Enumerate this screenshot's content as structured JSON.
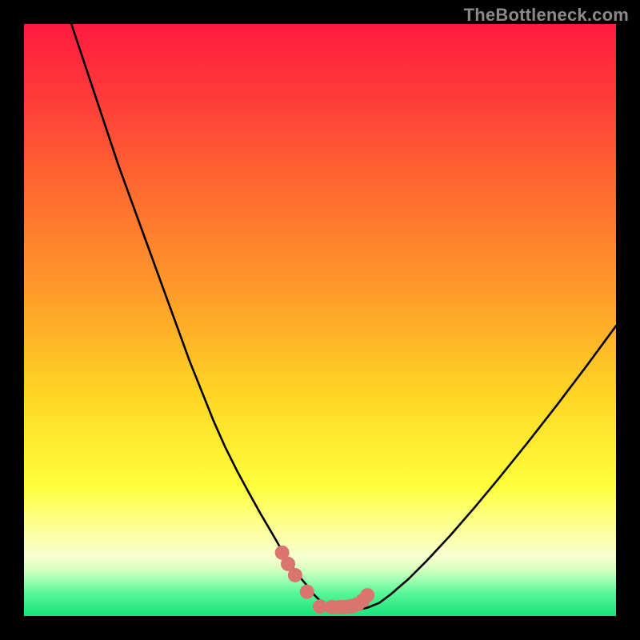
{
  "watermark": {
    "text": "TheBottleneck.com"
  },
  "chart_data": {
    "type": "line",
    "title": "",
    "xlabel": "",
    "ylabel": "",
    "xlim": [
      0,
      100
    ],
    "ylim": [
      0,
      100
    ],
    "grid": false,
    "legend": null,
    "gradient_stops": [
      {
        "pct": 0,
        "color": "#ff1b3f"
      },
      {
        "pct": 12,
        "color": "#ff3a3a"
      },
      {
        "pct": 28,
        "color": "#ff6a2f"
      },
      {
        "pct": 45,
        "color": "#ff9a2a"
      },
      {
        "pct": 62,
        "color": "#ffd324"
      },
      {
        "pct": 78,
        "color": "#ffff3a"
      },
      {
        "pct": 86,
        "color": "#fcffa0"
      },
      {
        "pct": 90,
        "color": "#f6ffd0"
      },
      {
        "pct": 92,
        "color": "#d9ffc0"
      },
      {
        "pct": 94,
        "color": "#9dffb0"
      },
      {
        "pct": 96,
        "color": "#5cf79a"
      },
      {
        "pct": 100,
        "color": "#14e37a"
      }
    ],
    "series": [
      {
        "name": "bottleneck-curve",
        "stroke": "#000000",
        "x": [
          8,
          10,
          12,
          14,
          16,
          18,
          20,
          22,
          24,
          26,
          28,
          30,
          32,
          34,
          36,
          38,
          40,
          42,
          43.5,
          45,
          46.5,
          48,
          49,
          50,
          51,
          52,
          53,
          54,
          55,
          56.5,
          58,
          60,
          62,
          65,
          68,
          72,
          76,
          80,
          85,
          90,
          95,
          100
        ],
        "y": [
          100,
          94,
          88,
          82,
          76,
          70.5,
          65,
          59.5,
          54,
          48.5,
          43,
          38,
          33,
          28.5,
          24.5,
          20.8,
          17.2,
          13.8,
          11.2,
          8.8,
          6.7,
          4.9,
          3.6,
          2.6,
          1.9,
          1.4,
          1.1,
          1.0,
          1.0,
          1.1,
          1.4,
          2.2,
          3.7,
          6.3,
          9.3,
          13.6,
          18.2,
          23.0,
          29.2,
          35.6,
          42.2,
          49.0
        ]
      }
    ],
    "markers": {
      "name": "highlighted-dots",
      "color": "#d9746e",
      "radius": 9,
      "x": [
        43.6,
        44.6,
        45.8,
        47.8,
        50.0,
        52.0,
        53.2,
        54.0,
        54.9,
        55.6,
        56.4,
        57.2,
        58.0
      ],
      "y": [
        10.7,
        8.8,
        6.9,
        4.1,
        1.6,
        1.5,
        1.5,
        1.5,
        1.6,
        1.7,
        2.0,
        2.6,
        3.5
      ]
    }
  }
}
